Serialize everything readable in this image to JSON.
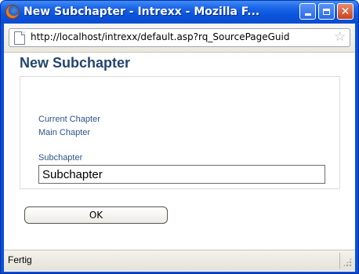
{
  "window": {
    "title": "New Subchapter - Intrexx - Mozilla F...",
    "icon": "firefox-icon"
  },
  "urlbar": {
    "url": "http://localhost/intrexx/default.asp?rq_SourcePageGuid"
  },
  "dialog": {
    "heading": "New Subchapter",
    "current_chapter_label": "Current Chapter",
    "current_chapter_value": "Main Chapter",
    "subchapter_label": "Subchapter",
    "subchapter_value": "Subchapter",
    "ok_label": "OK"
  },
  "statusbar": {
    "text": "Fertig"
  },
  "colors": {
    "titlebar": "#0a55dd",
    "heading": "#23466f",
    "label": "#2d5487"
  }
}
